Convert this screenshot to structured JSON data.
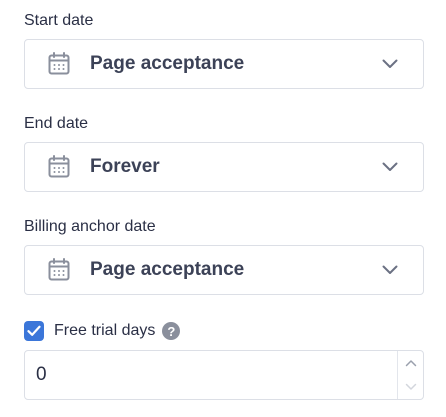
{
  "start_date": {
    "label": "Start date",
    "value": "Page acceptance",
    "icon": "calendar-icon"
  },
  "end_date": {
    "label": "End date",
    "value": "Forever",
    "icon": "calendar-icon"
  },
  "billing_anchor_date": {
    "label": "Billing anchor date",
    "value": "Page acceptance",
    "icon": "calendar-icon"
  },
  "free_trial": {
    "label": "Free trial days",
    "checked": true,
    "value": "0",
    "help_icon": "question-circle-icon"
  },
  "colors": {
    "checkbox": "#3b76d9",
    "border": "#dcdfe6",
    "text": "#3c4257",
    "icon": "#8a8f9c"
  }
}
